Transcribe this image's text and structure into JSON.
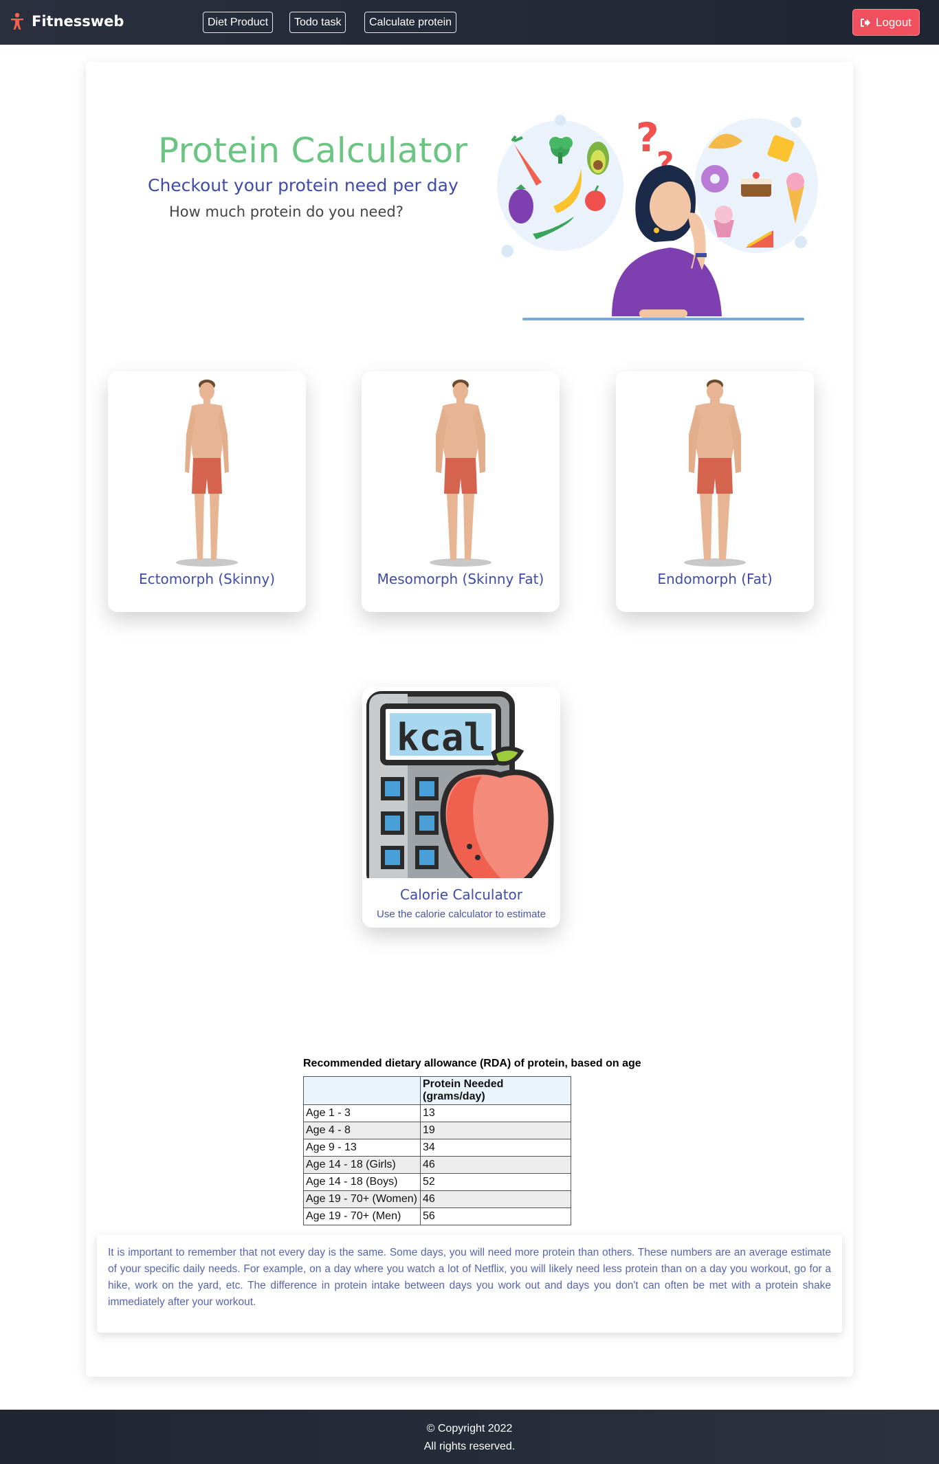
{
  "navbar": {
    "brand": "Fitnessweb",
    "brand_icon": "person-icon",
    "links": [
      "Diet Product",
      "Todo task",
      "Calculate protein"
    ],
    "logout_label": "Logout",
    "logout_icon": "sign-out-icon",
    "logout_color": "#f0505e"
  },
  "hero": {
    "title": "Protein Calculator",
    "subtitle": "Checkout your protein need per day",
    "question": "How much protein do you need?",
    "title_color": "#6cc482",
    "subtitle_color": "#3f4ba6"
  },
  "body_types": [
    {
      "label": "Ectomorph (Skinny)"
    },
    {
      "label": "Mesomorph (Skinny Fat)"
    },
    {
      "label": "Endomorph (Fat)"
    }
  ],
  "calorie_card": {
    "title": "Calorie Calculator",
    "description": "Use the calorie calculator to estimate",
    "screen_text": "kcal"
  },
  "rda_table": {
    "caption": "Recommended dietary allowance (RDA) of protein, based on age",
    "headers": [
      "",
      "Protein Needed (grams/day)"
    ],
    "rows": [
      [
        "Age 1 - 3",
        "13"
      ],
      [
        "Age 4 - 8",
        "19"
      ],
      [
        "Age 9 - 13",
        "34"
      ],
      [
        "Age 14 - 18 (Girls)",
        "46"
      ],
      [
        "Age 14 - 18 (Boys)",
        "52"
      ],
      [
        "Age 19 - 70+ (Women)",
        "46"
      ],
      [
        "Age 19 - 70+ (Men)",
        "56"
      ]
    ]
  },
  "note": "It is important to remember that not every day is the same. Some days, you will need more protein than others. These numbers are an average estimate of your specific daily needs. For example, on a day where you watch a lot of Netflix, you will likely need less protein than on a day you workout, go for a hike, work on the yard, etc. The difference in protein intake between days you work out and days you don't can often be met with a protein shake immediately after your workout.",
  "footer": {
    "copyright": "© Copyright 2022",
    "rights": "All rights reserved."
  }
}
